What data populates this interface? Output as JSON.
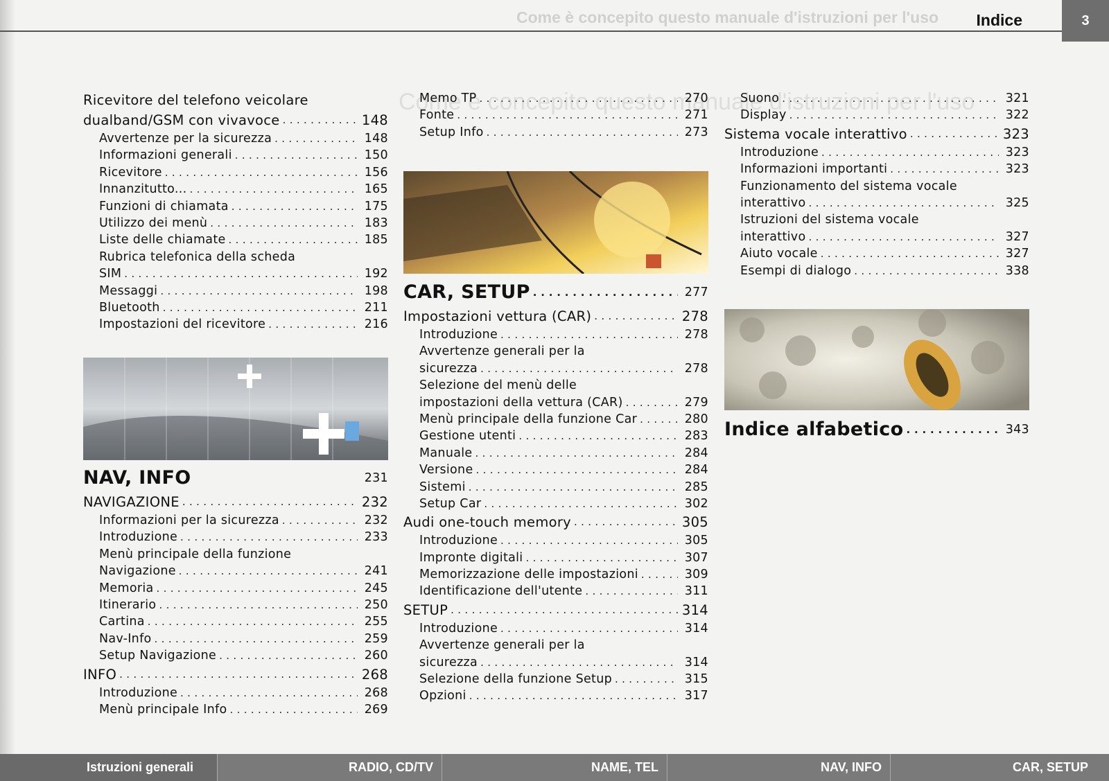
{
  "header": {
    "bleed_text": "Come è concepito questo manuale d'istruzioni per l'uso",
    "title": "Indice",
    "page_number": "3"
  },
  "col1": [
    {
      "label": "Ricevitore del telefono veicolare",
      "page": "",
      "cls": "h nodots"
    },
    {
      "label": "dualband/GSM con vivavoce",
      "page": "148",
      "cls": "h"
    },
    {
      "label": "Avvertenze per la sicurezza",
      "page": "148",
      "cls": "sub"
    },
    {
      "label": "Informazioni generali",
      "page": "150",
      "cls": "sub"
    },
    {
      "label": "Ricevitore",
      "page": "156",
      "cls": "sub"
    },
    {
      "label": "Innanzitutto...",
      "page": "165",
      "cls": "sub"
    },
    {
      "label": "Funzioni di chiamata",
      "page": "175",
      "cls": "sub"
    },
    {
      "label": "Utilizzo dei menù",
      "page": "183",
      "cls": "sub"
    },
    {
      "label": "Liste delle chiamate",
      "page": "185",
      "cls": "sub"
    },
    {
      "label": "Rubrica telefonica della scheda",
      "page": "",
      "cls": "sub nodots"
    },
    {
      "label": "SIM",
      "page": "192",
      "cls": "sub"
    },
    {
      "label": "Messaggi",
      "page": "198",
      "cls": "sub"
    },
    {
      "label": "Bluetooth",
      "page": "211",
      "cls": "sub"
    },
    {
      "label": "Impostazioni del ricevitore",
      "page": "216",
      "cls": "sub"
    }
  ],
  "col1b": [
    {
      "label": "NAV, INFO",
      "page": "231",
      "cls": "big nodots"
    },
    {
      "label": "NAVIGAZIONE",
      "page": "232",
      "cls": "h"
    },
    {
      "label": "Informazioni per la sicurezza",
      "page": "232",
      "cls": "sub"
    },
    {
      "label": "Introduzione",
      "page": "233",
      "cls": "sub"
    },
    {
      "label": "Menù principale della funzione",
      "page": "",
      "cls": "sub nodots"
    },
    {
      "label": "Navigazione",
      "page": "241",
      "cls": "sub"
    },
    {
      "label": "Memoria",
      "page": "245",
      "cls": "sub"
    },
    {
      "label": "Itinerario",
      "page": "250",
      "cls": "sub"
    },
    {
      "label": "Cartina",
      "page": "255",
      "cls": "sub"
    },
    {
      "label": "Nav-Info",
      "page": "259",
      "cls": "sub"
    },
    {
      "label": "Setup Navigazione",
      "page": "260",
      "cls": "sub"
    },
    {
      "label": "INFO",
      "page": "268",
      "cls": "h"
    },
    {
      "label": "Introduzione",
      "page": "268",
      "cls": "sub"
    },
    {
      "label": "Menù principale Info",
      "page": "269",
      "cls": "sub"
    }
  ],
  "col2a": [
    {
      "label": "Memo TP",
      "page": "270",
      "cls": "sub"
    },
    {
      "label": "Fonte",
      "page": "271",
      "cls": "sub"
    },
    {
      "label": "Setup Info",
      "page": "273",
      "cls": "sub"
    }
  ],
  "col2b": [
    {
      "label": "CAR, SETUP",
      "page": "277",
      "cls": "big"
    },
    {
      "label": "Impostazioni vettura (CAR)",
      "page": "278",
      "cls": "h"
    },
    {
      "label": "Introduzione",
      "page": "278",
      "cls": "sub"
    },
    {
      "label": "Avvertenze generali per la",
      "page": "",
      "cls": "sub nodots"
    },
    {
      "label": "sicurezza",
      "page": "278",
      "cls": "sub"
    },
    {
      "label": "Selezione del menù delle",
      "page": "",
      "cls": "sub nodots"
    },
    {
      "label": "impostazioni della vettura (CAR)",
      "page": "279",
      "cls": "sub"
    },
    {
      "label": "Menù principale della funzione Car",
      "page": "280",
      "cls": "sub"
    },
    {
      "label": "Gestione utenti",
      "page": "283",
      "cls": "sub"
    },
    {
      "label": "Manuale",
      "page": "284",
      "cls": "sub"
    },
    {
      "label": "Versione",
      "page": "284",
      "cls": "sub"
    },
    {
      "label": "Sistemi",
      "page": "285",
      "cls": "sub"
    },
    {
      "label": "Setup Car",
      "page": "302",
      "cls": "sub"
    },
    {
      "label": "Audi one-touch memory",
      "page": "305",
      "cls": "h"
    },
    {
      "label": "Introduzione",
      "page": "305",
      "cls": "sub"
    },
    {
      "label": "Impronte digitali",
      "page": "307",
      "cls": "sub"
    },
    {
      "label": "Memorizzazione delle impostazioni",
      "page": "309",
      "cls": "sub"
    },
    {
      "label": "Identificazione dell'utente",
      "page": "311",
      "cls": "sub"
    },
    {
      "label": "SETUP",
      "page": "314",
      "cls": "h"
    },
    {
      "label": "Introduzione",
      "page": "314",
      "cls": "sub"
    },
    {
      "label": "Avvertenze generali per la",
      "page": "",
      "cls": "sub nodots"
    },
    {
      "label": "sicurezza",
      "page": "314",
      "cls": "sub"
    },
    {
      "label": "Selezione della funzione Setup",
      "page": "315",
      "cls": "sub"
    },
    {
      "label": "Opzioni",
      "page": "317",
      "cls": "sub"
    }
  ],
  "col3a": [
    {
      "label": "Suono",
      "page": "321",
      "cls": "sub"
    },
    {
      "label": "Display",
      "page": "322",
      "cls": "sub"
    },
    {
      "label": "Sistema vocale interattivo",
      "page": "323",
      "cls": "h"
    },
    {
      "label": "Introduzione",
      "page": "323",
      "cls": "sub"
    },
    {
      "label": "Informazioni importanti",
      "page": "323",
      "cls": "sub"
    },
    {
      "label": "Funzionamento del sistema vocale",
      "page": "",
      "cls": "sub nodots"
    },
    {
      "label": "interattivo",
      "page": "325",
      "cls": "sub"
    },
    {
      "label": "Istruzioni del sistema vocale",
      "page": "",
      "cls": "sub nodots"
    },
    {
      "label": "interattivo",
      "page": "327",
      "cls": "sub"
    },
    {
      "label": "Aiuto vocale",
      "page": "327",
      "cls": "sub"
    },
    {
      "label": "Esempi di dialogo",
      "page": "338",
      "cls": "sub"
    }
  ],
  "col3b": [
    {
      "label": "Indice alfabetico",
      "page": "343",
      "cls": "big"
    }
  ],
  "bottom_tabs": [
    "Istruzioni generali",
    "RADIO, CD/TV",
    "NAME, TEL",
    "NAV, INFO",
    "CAR, SETUP"
  ]
}
